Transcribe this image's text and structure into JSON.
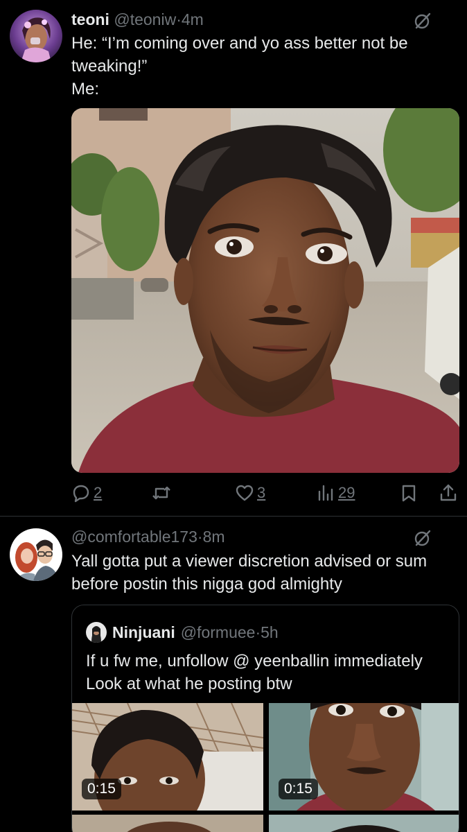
{
  "tweet1": {
    "display_name": "teoni",
    "handle": "@teoniw",
    "separator": "·",
    "time": "4m",
    "text_lines": [
      "He: “I’m coming over and yo ass better not be",
      "tweaking!”",
      "Me:"
    ],
    "actions": {
      "replies": "2",
      "likes": "3",
      "views": "29"
    }
  },
  "tweet2": {
    "handle": "@comfortable173",
    "separator": "·",
    "time": "8m",
    "text_lines": [
      "Yall gotta put a viewer discretion advised or sum",
      "before postin this nigga god almighty"
    ],
    "quote": {
      "display_name": "Ninjuani",
      "handle": "@formuee",
      "separator": "·",
      "time": "5h",
      "text_lines": [
        "If u fw me, unfollow @ yeenballin immediately",
        "Look at what he posting btw"
      ],
      "videos": [
        {
          "duration": "0:15"
        },
        {
          "duration": "0:15"
        }
      ]
    }
  },
  "icons": {
    "grok": "grok-icon",
    "reply": "reply-icon",
    "retweet": "retweet-icon",
    "like": "heart-icon",
    "views": "views-icon",
    "bookmark": "bookmark-icon",
    "share": "share-icon"
  },
  "colors": {
    "background": "#000000",
    "text": "#e7e9ea",
    "muted": "#71767b",
    "divider": "#2f3336"
  }
}
